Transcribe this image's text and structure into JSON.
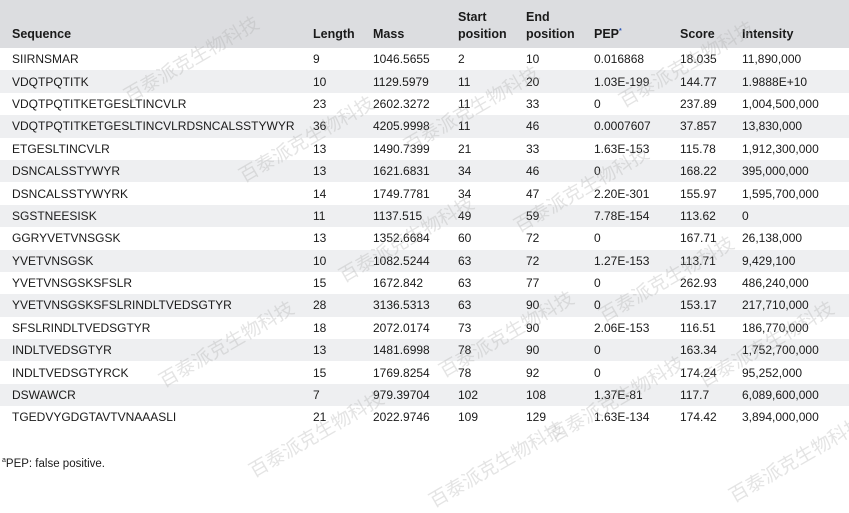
{
  "headers": {
    "sequence": "Sequence",
    "length": "Length",
    "mass": "Mass",
    "start": "Start position",
    "end": "End position",
    "pep": "PEP",
    "pep_marker": "*",
    "score": "Score",
    "intensity": "Intensity"
  },
  "rows": [
    {
      "sequence": "SIIRNSMAR",
      "length": "9",
      "mass": "1046.5655",
      "start": "2",
      "end": "10",
      "pep": "0.016868",
      "score": "18.035",
      "intensity": "11,890,000"
    },
    {
      "sequence": "VDQTPQTITK",
      "length": "10",
      "mass": "1129.5979",
      "start": "11",
      "end": "20",
      "pep": "1.03E-199",
      "score": "144.77",
      "intensity": "1.9888E+10"
    },
    {
      "sequence": "VDQTPQTITKETGESLTINCVLR",
      "length": "23",
      "mass": "2602.3272",
      "start": "11",
      "end": "33",
      "pep": "0",
      "score": "237.89",
      "intensity": "1,004,500,000"
    },
    {
      "sequence": "VDQTPQTITKETGESLTINCVLRDSNCALSSTYWYR",
      "length": "36",
      "mass": "4205.9998",
      "start": "11",
      "end": "46",
      "pep": "0.0007607",
      "score": "37.857",
      "intensity": "13,830,000"
    },
    {
      "sequence": "ETGESLTINCVLR",
      "length": "13",
      "mass": "1490.7399",
      "start": "21",
      "end": "33",
      "pep": "1.63E-153",
      "score": "115.78",
      "intensity": "1,912,300,000"
    },
    {
      "sequence": "DSNCALSSTYWYR",
      "length": "13",
      "mass": "1621.6831",
      "start": "34",
      "end": "46",
      "pep": "0",
      "score": "168.22",
      "intensity": "395,000,000"
    },
    {
      "sequence": "DSNCALSSTYWYRK",
      "length": "14",
      "mass": "1749.7781",
      "start": "34",
      "end": "47",
      "pep": "2.20E-301",
      "score": "155.97",
      "intensity": "1,595,700,000"
    },
    {
      "sequence": "SGSTNEESISK",
      "length": "11",
      "mass": "1137.515",
      "start": "49",
      "end": "59",
      "pep": "7.78E-154",
      "score": "113.62",
      "intensity": "0"
    },
    {
      "sequence": "GGRYVETVNSGSK",
      "length": "13",
      "mass": "1352.6684",
      "start": "60",
      "end": "72",
      "pep": "0",
      "score": "167.71",
      "intensity": "26,138,000"
    },
    {
      "sequence": "YVETVNSGSK",
      "length": "10",
      "mass": "1082.5244",
      "start": "63",
      "end": "72",
      "pep": "1.27E-153",
      "score": "113.71",
      "intensity": "9,429,100"
    },
    {
      "sequence": "YVETVNSGSKSFSLR",
      "length": "15",
      "mass": "1672.842",
      "start": "63",
      "end": "77",
      "pep": "0",
      "score": "262.93",
      "intensity": "486,240,000"
    },
    {
      "sequence": "YVETVNSGSKSFSLRINDLTVEDSGTYR",
      "length": "28",
      "mass": "3136.5313",
      "start": "63",
      "end": "90",
      "pep": "0",
      "score": "153.17",
      "intensity": "217,710,000"
    },
    {
      "sequence": "SFSLRINDLTVEDSGTYR",
      "length": "18",
      "mass": "2072.0174",
      "start": "73",
      "end": "90",
      "pep": "2.06E-153",
      "score": "116.51",
      "intensity": "186,770,000"
    },
    {
      "sequence": "INDLTVEDSGTYR",
      "length": "13",
      "mass": "1481.6998",
      "start": "78",
      "end": "90",
      "pep": "0",
      "score": "163.34",
      "intensity": "1,752,700,000"
    },
    {
      "sequence": "INDLTVEDSGTYRCK",
      "length": "15",
      "mass": "1769.8254",
      "start": "78",
      "end": "92",
      "pep": "0",
      "score": "174.24",
      "intensity": "95,252,000"
    },
    {
      "sequence": "DSWAWCR",
      "length": "7",
      "mass": "979.39704",
      "start": "102",
      "end": "108",
      "pep": "1.37E-81",
      "score": "117.7",
      "intensity": "6,089,600,000"
    },
    {
      "sequence": "TGEDVYGDGTAVTVNAAASLI",
      "length": "21",
      "mass": "2022.9746",
      "start": "109",
      "end": "129",
      "pep": "1.63E-134",
      "score": "174.42",
      "intensity": "3,894,000,000"
    }
  ],
  "footnote": {
    "marker": "a",
    "text": "PEP: false positive."
  },
  "watermark": "百泰派克生物科技"
}
